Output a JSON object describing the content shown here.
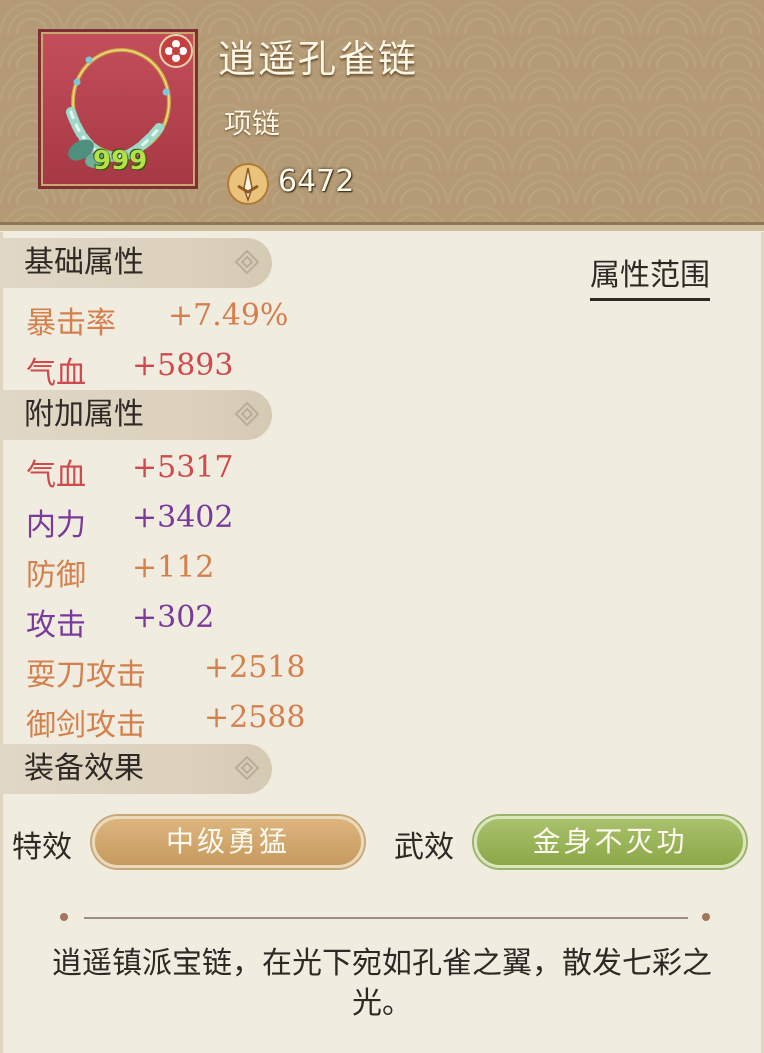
{
  "item": {
    "name": "逍遥孔雀链",
    "type": "项链",
    "count": "999",
    "power": "6472",
    "icon": "peacock-necklace-icon"
  },
  "sections": {
    "base": "基础属性",
    "extra": "附加属性",
    "effects": "装备效果"
  },
  "range_link": "属性范围",
  "base_stats": [
    {
      "name": "暴击率",
      "value": "+7.49%",
      "color": "#d3804d"
    },
    {
      "name": "气血",
      "value": "+5893",
      "color": "#cf4a4c"
    }
  ],
  "extra_stats": [
    {
      "name": "气血",
      "value": "+5317",
      "color": "#cf4a4c"
    },
    {
      "name": "内力",
      "value": "+3402",
      "color": "#7a3a9a"
    },
    {
      "name": "防御",
      "value": "+112",
      "color": "#d3804d"
    },
    {
      "name": "攻击",
      "value": "+302",
      "color": "#7a3a9a"
    },
    {
      "name": "耍刀攻击",
      "value": "+2518",
      "color": "#d3804d"
    },
    {
      "name": "御剑攻击",
      "value": "+2588",
      "color": "#d3804d"
    }
  ],
  "effects": {
    "special_label": "特效",
    "special_value": "中级勇猛",
    "martial_label": "武效",
    "martial_value": "金身不灭功"
  },
  "description": "逍遥镇派宝链，在光下宛如孔雀之翼，散发七彩之光。"
}
